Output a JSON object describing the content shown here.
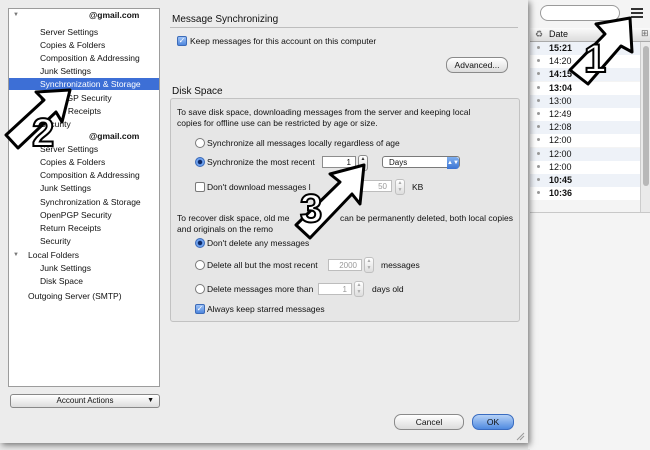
{
  "background_app": {
    "column_header": {
      "date_label": "Date",
      "left_icon": "recycle-icon",
      "right_icon": "column-picker-icon"
    },
    "times": [
      {
        "time": "15:21",
        "bold": true
      },
      {
        "time": "14:20",
        "bold": false
      },
      {
        "time": "14:15",
        "bold": true
      },
      {
        "time": "13:04",
        "bold": true
      },
      {
        "time": "13:00",
        "bold": false
      },
      {
        "time": "12:49",
        "bold": false
      },
      {
        "time": "12:08",
        "bold": false
      },
      {
        "time": "12:00",
        "bold": false
      },
      {
        "time": "12:00",
        "bold": false
      },
      {
        "time": "12:00",
        "bold": false
      },
      {
        "time": "10:45",
        "bold": true
      },
      {
        "time": "10:36",
        "bold": true
      }
    ]
  },
  "sidebar": {
    "account1": {
      "name": "@gmail.com",
      "items": [
        "Server Settings",
        "Copies & Folders",
        "Composition & Addressing",
        "Junk Settings",
        "Synchronization & Storage",
        "OpenPGP Security",
        "Return Receipts",
        "Security"
      ]
    },
    "account2": {
      "name": "@gmail.com",
      "items": [
        "Server Settings",
        "Copies & Folders",
        "Composition & Addressing",
        "Junk Settings",
        "Synchronization & Storage",
        "OpenPGP Security",
        "Return Receipts",
        "Security"
      ]
    },
    "local_folders": {
      "name": "Local Folders",
      "items": [
        "Junk Settings",
        "Disk Space"
      ]
    },
    "outgoing": "Outgoing Server (SMTP)",
    "account_actions": "Account Actions"
  },
  "main": {
    "msg_sync": {
      "title": "Message Synchronizing",
      "keep_messages": "Keep messages for this account on this computer",
      "advanced": "Advanced..."
    },
    "disk_space": {
      "title": "Disk Space",
      "intro_line1": "To save disk space, downloading messages from the server and keeping local",
      "intro_line2": "copies for offline use can be restricted by age or size.",
      "sync_all": "Synchronize all messages locally regardless of age",
      "sync_recent": "Synchronize the most recent",
      "sync_recent_value": "1",
      "sync_unit": "Days",
      "dont_download_prefix": "Don't download messages l",
      "dont_download_suffix": "han",
      "size_value": "50",
      "size_unit": "KB",
      "recover_line1_a": "To recover disk space, old me",
      "recover_line1_b": "can be permanently deleted, both local copies",
      "recover_line2_a": "and originals on the remo",
      "recover_line2_b": "ve",
      "dont_delete": "Don't delete any messages",
      "delete_all_but": "Delete all but the most recent",
      "delete_all_value": "2000",
      "delete_all_unit": "messages",
      "delete_older": "Delete messages more than",
      "delete_older_value": "1",
      "delete_older_unit": "days old",
      "keep_starred": "Always keep starred messages"
    },
    "buttons": {
      "cancel": "Cancel",
      "ok": "OK"
    }
  },
  "annotations": {
    "arrow1": "1",
    "arrow2": "2",
    "arrow3": "3"
  }
}
